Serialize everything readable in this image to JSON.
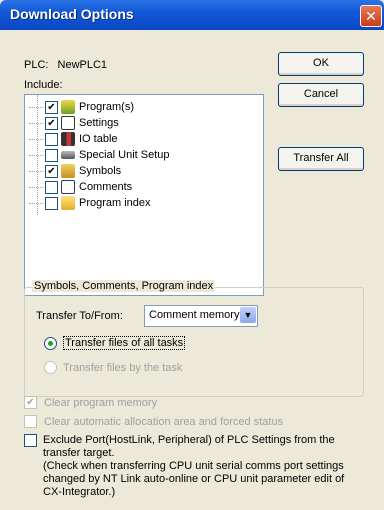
{
  "dialog": {
    "title": "Download Options"
  },
  "plc": {
    "label": "PLC:",
    "name": "NewPLC1"
  },
  "include_label": "Include:",
  "tree": {
    "items": [
      {
        "label": "Program(s)",
        "checked": "✔",
        "icon": "program-icon"
      },
      {
        "label": "Settings",
        "checked": "✔",
        "icon": "settings-icon"
      },
      {
        "label": "IO table",
        "checked": "",
        "icon": "io-table-icon"
      },
      {
        "label": "Special Unit Setup",
        "checked": "",
        "icon": "special-unit-icon"
      },
      {
        "label": "Symbols",
        "checked": "✔",
        "icon": "symbols-icon"
      },
      {
        "label": "Comments",
        "checked": "",
        "icon": "comments-icon"
      },
      {
        "label": "Program index",
        "checked": "",
        "icon": "folder-icon"
      }
    ]
  },
  "buttons": {
    "ok": "OK",
    "cancel": "Cancel",
    "transfer_all": "Transfer All"
  },
  "group": {
    "legend": "Symbols, Comments, Program index",
    "transfer_label": "Transfer To/From:",
    "transfer_value": "Comment memory",
    "radio_all": "Transfer files of all tasks",
    "radio_task": "Transfer files by the task"
  },
  "options": {
    "clear_program": "Clear program memory",
    "clear_auto": "Clear automatic allocation area and forced status",
    "exclude_line1": "Exclude Port(HostLink, Peripheral) of PLC Settings from the",
    "exclude_line2": "transfer target.",
    "exclude_line3": "(Check when transferring CPU unit serial comms port settings",
    "exclude_line4": "changed by NT Link auto-online or CPU unit parameter edit of",
    "exclude_line5": "CX-Integrator.)"
  }
}
